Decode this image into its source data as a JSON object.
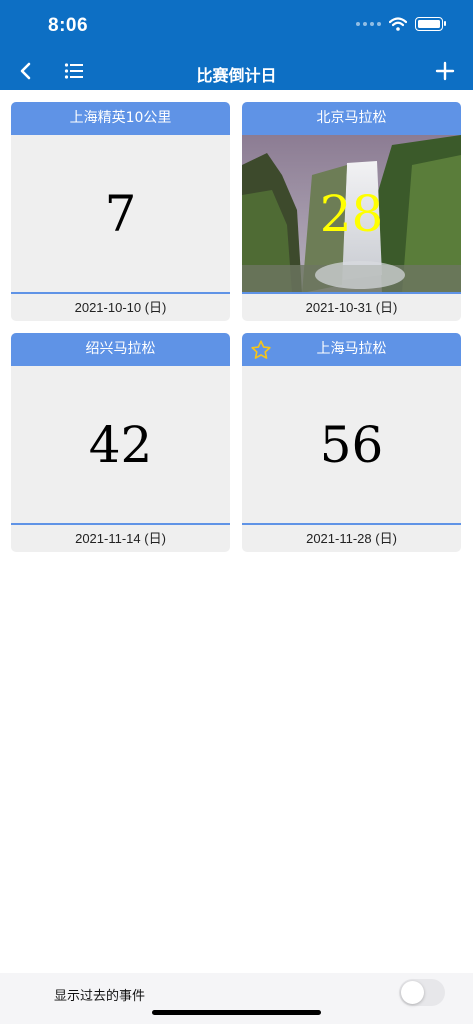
{
  "status_bar": {
    "time": "8:06"
  },
  "nav": {
    "title": "比赛倒计日"
  },
  "cards": [
    {
      "title": "上海精英10公里",
      "days": "7",
      "date": "2021-10-10 (日)"
    },
    {
      "title": "北京马拉松",
      "days": "28",
      "date": "2021-10-31 (日)",
      "has_image": true,
      "number_color": "#ffff00"
    },
    {
      "title": "绍兴马拉松",
      "days": "42",
      "date": "2021-11-14 (日)"
    },
    {
      "title": "上海马拉松",
      "days": "56",
      "date": "2021-11-28 (日)",
      "starred": true
    }
  ],
  "footer": {
    "label": "显示过去的事件",
    "toggle_on": false
  },
  "colors": {
    "nav_bg": "#0d6fc4",
    "card_header": "#5f93e6",
    "star": "#f5c518"
  }
}
